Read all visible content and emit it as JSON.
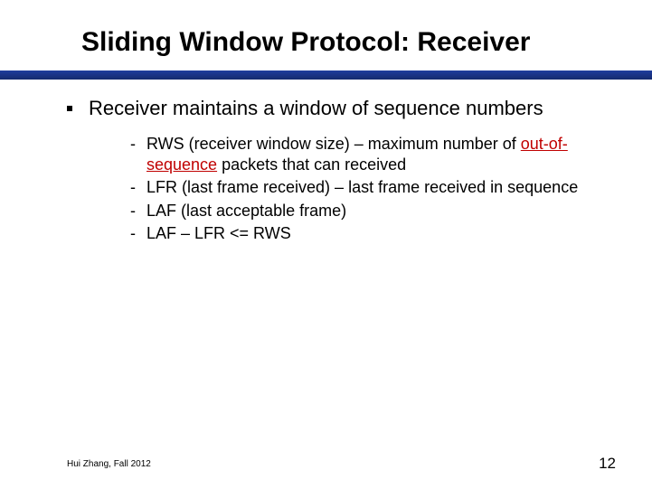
{
  "title": "Sliding Window Protocol: Receiver",
  "main_bullet": "Receiver maintains a window of sequence numbers",
  "sub": {
    "a": {
      "pre": "RWS (receiver window size) – maximum number of ",
      "red_ul": "out-of-sequence",
      "post": " packets that can received"
    },
    "b": "LFR (last frame received) – last frame received in sequence",
    "c": "LAF (last acceptable frame)",
    "d": "LAF – LFR <= RWS"
  },
  "footer": {
    "author": "Hui Zhang, Fall 2012",
    "page": "12"
  }
}
